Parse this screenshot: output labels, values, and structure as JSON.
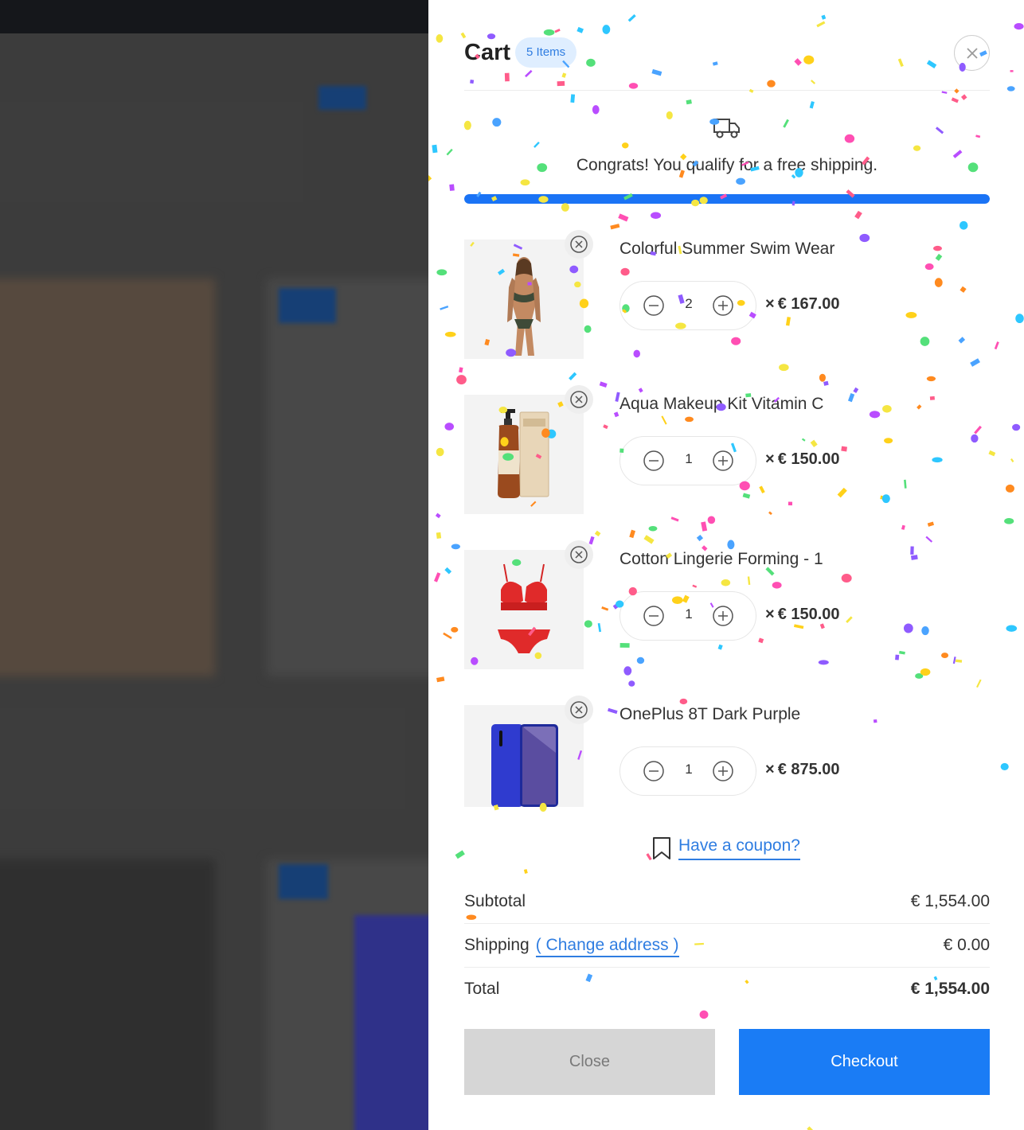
{
  "cart": {
    "title": "Cart",
    "badge": "5 Items",
    "close_icon": "close-icon"
  },
  "shipping_notice": {
    "icon": "truck-icon",
    "message": "Congrats! You qualify for a free shipping.",
    "progress_fraction": 1.0,
    "progress_color": "#1a73f5"
  },
  "items": [
    {
      "name": "Colorful Summer Swim Wear",
      "quantity": "2",
      "times": "×",
      "price": "€ 167.00",
      "image": "swimwear-photo"
    },
    {
      "name": "Aqua Makeup Kit Vitamin C",
      "quantity": "1",
      "times": "×",
      "price": "€ 150.00",
      "image": "cosmetics-bottle-photo"
    },
    {
      "name": "Cotton Lingerie Forming - 1",
      "quantity": "1",
      "times": "×",
      "price": "€ 150.00",
      "image": "lingerie-photo"
    },
    {
      "name": "OnePlus 8T Dark Purple",
      "quantity": "1",
      "times": "×",
      "price": "€ 875.00",
      "image": "phone-photo"
    }
  ],
  "coupon": {
    "icon": "bookmark-icon",
    "label": "Have a coupon?"
  },
  "totals": {
    "subtotal_label": "Subtotal",
    "subtotal_value": "€ 1,554.00",
    "shipping_label": "Shipping",
    "change_address_label": "( Change address )",
    "shipping_value": "€ 0.00",
    "total_label": "Total",
    "total_value": "€ 1,554.00"
  },
  "actions": {
    "close_label": "Close",
    "checkout_label": "Checkout"
  },
  "colors": {
    "accent": "#1a7cf5",
    "badge_bg": "#dfeeff",
    "link": "#2f7de1"
  }
}
